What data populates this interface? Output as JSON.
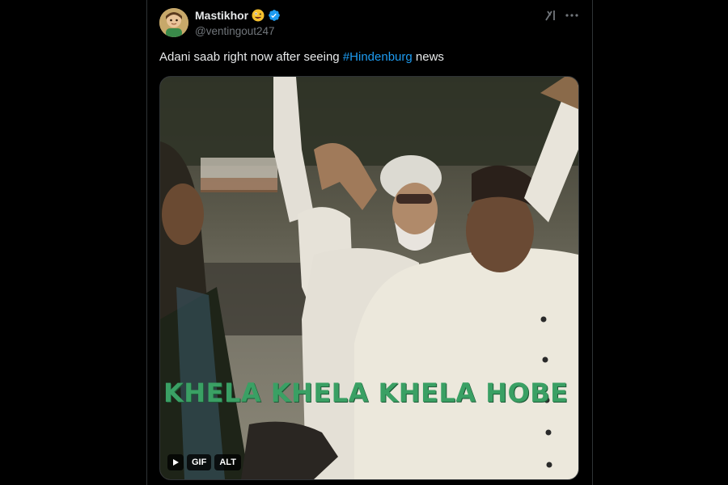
{
  "tweet": {
    "display_name": "Mastikhor",
    "handle": "@ventingout247",
    "text_before": "Adani saab right now after seeing ",
    "hashtag": "#Hindenburg",
    "text_after": " news",
    "verified": true
  },
  "media": {
    "caption": "KHELA KHELA KHELA HOBE",
    "badge_gif": "GIF",
    "badge_alt": "ALT"
  },
  "icons": {
    "grok": "grok-icon",
    "more": "more-icon",
    "play": "play-icon",
    "verified": "verified-badge-icon",
    "emoji": "zany-face-emoji-icon"
  },
  "colors": {
    "background": "#000000",
    "text": "#e7e9ea",
    "secondary": "#71767b",
    "link": "#1d9bf0",
    "verified": "#1d9bf0",
    "caption": "#3aa064"
  }
}
